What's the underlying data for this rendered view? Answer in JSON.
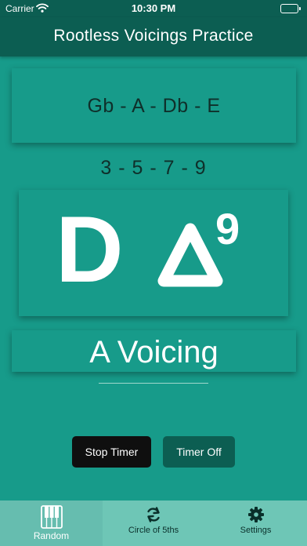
{
  "status_bar": {
    "carrier": "Carrier",
    "time": "10:30 PM",
    "icons": [
      "wifi-icon",
      "battery-icon"
    ]
  },
  "nav": {
    "title": "Rootless Voicings Practice"
  },
  "notes": {
    "text": "Gb - A - Db - E"
  },
  "degrees": {
    "text": "3 - 5 - 7 - 9"
  },
  "chord": {
    "root": "D",
    "quality_symbol": "major-triangle",
    "extension": "9"
  },
  "voicing": {
    "text": "A Voicing"
  },
  "buttons": {
    "stop_timer": "Stop Timer",
    "timer_off": "Timer Off"
  },
  "tabs": [
    {
      "label": "Random",
      "icon": "piano-keys-icon",
      "selected": true
    },
    {
      "label": "Circle of 5ths",
      "icon": "refresh-cycle-icon",
      "selected": false
    },
    {
      "label": "Settings",
      "icon": "gear-icon",
      "selected": false
    }
  ],
  "colors": {
    "background": "#179b8a",
    "nav_bar": "#0c5e52",
    "tab_bar": "#6ec6b6",
    "stop_button": "#0f0f0f",
    "off_button": "#0c5e52",
    "dark_text": "#0f2f2a",
    "light_text": "#ffffff"
  }
}
